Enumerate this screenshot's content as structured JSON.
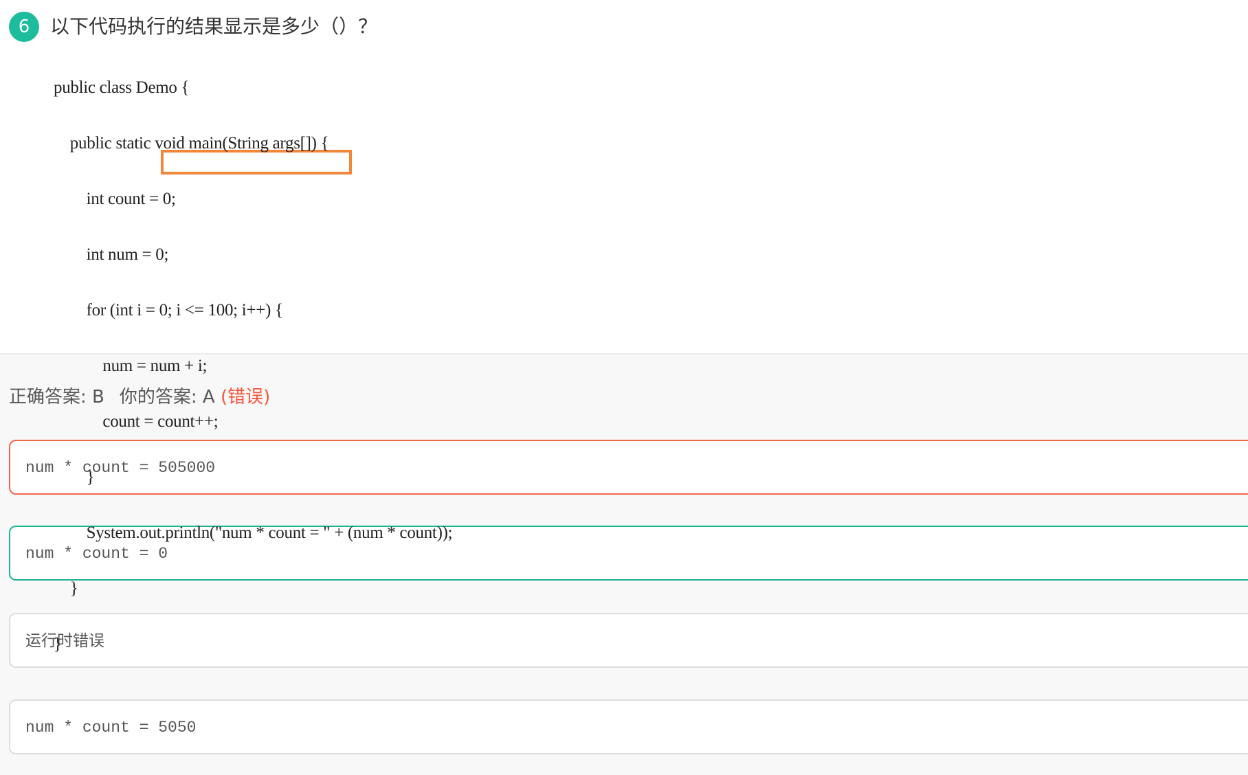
{
  "question": {
    "number": "6",
    "title": "以下代码执行的结果显示是多少（）？",
    "code_lines": [
      "public class Demo {",
      "    public static void main(String args[]) {",
      "        int count = 0;",
      "        int num = 0;",
      "        for (int i = 0; i <= 100; i++) {",
      "            num = num + i;",
      "            count = count++;",
      "        }",
      "        System.out.println(\"num * count = \" + (num * count));",
      "    }",
      "}"
    ],
    "highlight_color": "#f2873a"
  },
  "result": {
    "correct_label": "正确答案: B",
    "your_label": "你的答案: A",
    "status": "(错误)",
    "status_color": "#f5563b"
  },
  "options": [
    {
      "text": "num * count = 505000",
      "state": "selected-wrong",
      "border_color": "#f5654a"
    },
    {
      "text": "num * count = 0",
      "state": "correct",
      "border_color": "#1db394"
    },
    {
      "text": "运行时错误",
      "state": "normal"
    },
    {
      "text": "num * count = 5050",
      "state": "normal"
    }
  ]
}
